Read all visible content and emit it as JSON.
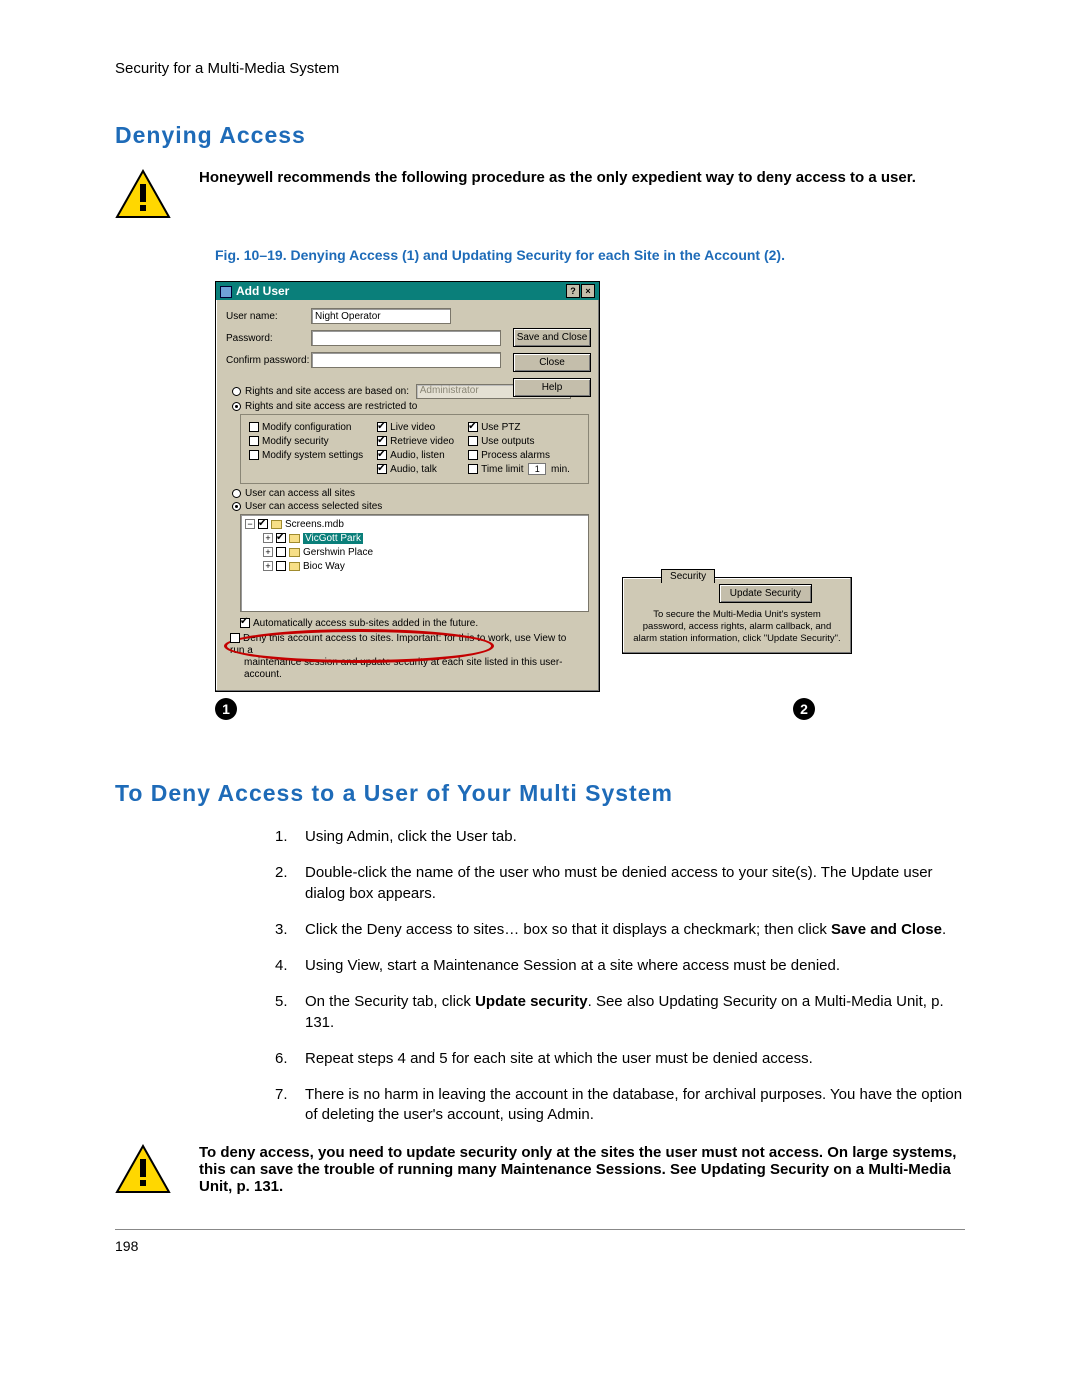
{
  "header": {
    "text": "Security for a Multi-Media System"
  },
  "section1": {
    "title": "Denying Access",
    "warning": "Honeywell recommends the following procedure as the only expedient way to deny access to a user.",
    "fig_caption": "Fig. 10–19.  Denying Access (1) and Updating Security for each Site in the Account (2)."
  },
  "dialog": {
    "title": "Add User",
    "close_help": "?",
    "close_x": "×",
    "labels": {
      "username": "User name:",
      "password": "Password:",
      "confirm": "Confirm password:"
    },
    "username_value": "Night Operator",
    "buttons": {
      "save": "Save and Close",
      "close": "Close",
      "help": "Help"
    },
    "radio_based_on": "Rights and site access are based on:",
    "based_on_combo": "Administrator",
    "radio_restricted": "Rights and site access are restricted to",
    "rights_col1": [
      "Modify configuration",
      "Modify security",
      "Modify system settings"
    ],
    "rights_col2": [
      "Live video",
      "Retrieve video",
      "Audio, listen",
      "Audio, talk"
    ],
    "rights_col3": [
      "Use PTZ",
      "Use outputs",
      "Process alarms"
    ],
    "time_limit_label": "Time limit",
    "time_limit_val": "1",
    "time_limit_unit": "min.",
    "radio_all_sites": "User can access all sites",
    "radio_sel_sites": "User can access selected sites",
    "tree": {
      "root": "Screens.mdb",
      "n1": "VicGott Park",
      "n2": "Gershwin Place",
      "n3": "Bioc Way"
    },
    "auto_access": "Automatically access sub-sites added in the future.",
    "deny1": "Deny this account access to sites. Important: for this to work, use View to run a",
    "deny2": "maintenance session and update security at each site listed in this user-account."
  },
  "callout1": "1",
  "callout2": "2",
  "sec_panel": {
    "tab": "Security",
    "button": "Update Security",
    "note": "To secure the Multi-Media Unit's system password, access rights, alarm callback, and alarm station information, click \"Update Security\"."
  },
  "section2": {
    "title": "To Deny Access to a User of Your Multi System",
    "steps": [
      "Using Admin, click the User tab.",
      "Double-click the name of the user who must be denied access to your site(s). The Update user dialog box appears.",
      "Click the Deny access to sites… box so that it displays a checkmark; then click **Save and Close**.",
      "Using View, start a Maintenance Session at a site where access must be denied.",
      "On the Security tab, click **Update security**. See also Updating Security on a Multi-Media Unit, p. 131.",
      "Repeat steps 4 and 5 for each site at which the user must be denied access.",
      "There is no harm in leaving the account in the database, for archival purposes. You have the option of deleting the user's account, using Admin."
    ],
    "step3_pre": "Click the Deny access to sites… box so that it displays a checkmark; then click ",
    "step3_bold": "Save and Close",
    "step3_post": ".",
    "step5_pre": "On the Security tab, click ",
    "step5_bold": "Update security",
    "step5_post": ". See also Updating Security on a Multi-Media Unit, p. 131.",
    "warning2": "To deny access, you need to update security only at the sites the user must not access. On large systems, this can save the trouble of running many Maintenance Sessions. See Updating Security on a Multi-Media Unit, p. 131."
  },
  "page_number": "198"
}
